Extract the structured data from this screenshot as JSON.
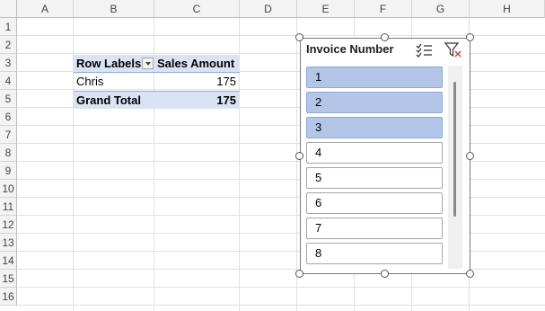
{
  "columns": [
    "A",
    "B",
    "C",
    "D",
    "E",
    "F",
    "G",
    "H"
  ],
  "rows": [
    "1",
    "2",
    "3",
    "4",
    "5",
    "6",
    "7",
    "8",
    "9",
    "10",
    "11",
    "12",
    "13",
    "14",
    "15",
    "16"
  ],
  "pivot": {
    "header_row_labels": "Row Labels",
    "header_sales_amount": "Sales Amount",
    "rows": [
      {
        "label": "Chris",
        "value": "175"
      }
    ],
    "grand_total_label": "Grand Total",
    "grand_total_value": "175"
  },
  "slicer": {
    "title": "Invoice Number",
    "items": [
      {
        "label": "1",
        "selected": true
      },
      {
        "label": "2",
        "selected": true
      },
      {
        "label": "3",
        "selected": true
      },
      {
        "label": "4",
        "selected": false
      },
      {
        "label": "5",
        "selected": false
      },
      {
        "label": "6",
        "selected": false
      },
      {
        "label": "7",
        "selected": false
      },
      {
        "label": "8",
        "selected": false
      }
    ]
  },
  "colors": {
    "pivot_header_fill": "#dae3f3",
    "slicer_selected_fill": "#b4c6e7",
    "clear_filter_accent": "#e23b3b"
  },
  "icons": {
    "multi_select": "multi-select-icon",
    "clear_filter": "clear-filter-icon"
  }
}
